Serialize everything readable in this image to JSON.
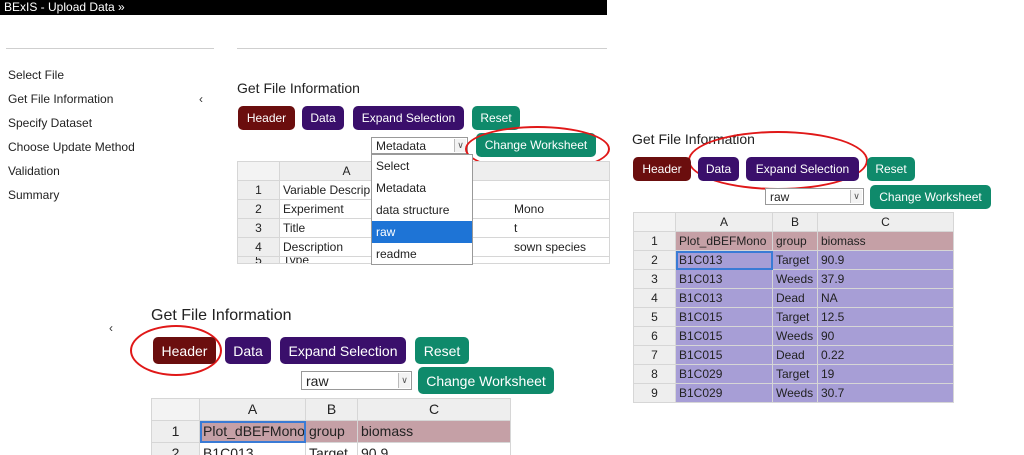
{
  "app": {
    "title": "BExIS - Upload Data »"
  },
  "nav": {
    "items": [
      "Select File",
      "Get File Information",
      "Specify Dataset",
      "Choose Update Method",
      "Validation",
      "Summary"
    ],
    "collapse_glyph": "‹"
  },
  "panel1": {
    "title": "Get File Information",
    "buttons": {
      "header": "Header",
      "data": "Data",
      "expand": "Expand Selection",
      "reset": "Reset",
      "change": "Change Worksheet"
    },
    "select_value": "Metadata",
    "select_arrow": "∨",
    "options": [
      "Select",
      "Metadata",
      "data structure",
      "raw",
      "readme"
    ],
    "selected_option": "raw",
    "grid": {
      "cols": [
        "A"
      ],
      "rows": [
        {
          "n": "1",
          "a": "Variable Descrip",
          "b": ""
        },
        {
          "n": "2",
          "a": "Experiment",
          "b": "Mono"
        },
        {
          "n": "3",
          "a": "Title",
          "b": "t"
        },
        {
          "n": "4",
          "a": "Description",
          "b": "sown species"
        },
        {
          "n": "5",
          "a": "Type",
          "b": ""
        }
      ]
    }
  },
  "panel2": {
    "title": "Get File Information",
    "buttons": {
      "header": "Header",
      "data": "Data",
      "expand": "Expand Selection",
      "reset": "Reset",
      "change": "Change Worksheet"
    },
    "select_value": "raw",
    "select_arrow": "∨",
    "grid": {
      "cols": [
        "A",
        "B",
        "C"
      ],
      "rows": [
        [
          "1",
          "Plot_dBEFMono",
          "group",
          "biomass"
        ],
        [
          "2",
          "B1C013",
          "Target",
          "90.9"
        ],
        [
          "3",
          "B1C013",
          "Weeds",
          "37.9"
        ],
        [
          "4",
          "B1C013",
          "Dead",
          "NA"
        ],
        [
          "5",
          "B1C015",
          "Target",
          "12.5"
        ],
        [
          "6",
          "B1C015",
          "Weeds",
          "90"
        ],
        [
          "7",
          "B1C015",
          "Dead",
          "0.22"
        ],
        [
          "8",
          "B1C029",
          "Target",
          "19"
        ],
        [
          "9",
          "B1C029",
          "Weeds",
          "30.7"
        ]
      ]
    }
  },
  "panel3": {
    "title": "Get File Information",
    "collapse_glyph": "‹",
    "buttons": {
      "header": "Header",
      "data": "Data",
      "expand": "Expand Selection",
      "reset": "Reset",
      "change": "Change Worksheet"
    },
    "select_value": "raw",
    "select_arrow": "∨",
    "grid": {
      "cols": [
        "A",
        "B",
        "C"
      ],
      "rows": [
        [
          "1",
          "Plot_dBEFMono",
          "group",
          "biomass"
        ],
        [
          "2",
          "B1C013",
          "Target",
          "90.9"
        ]
      ]
    }
  }
}
